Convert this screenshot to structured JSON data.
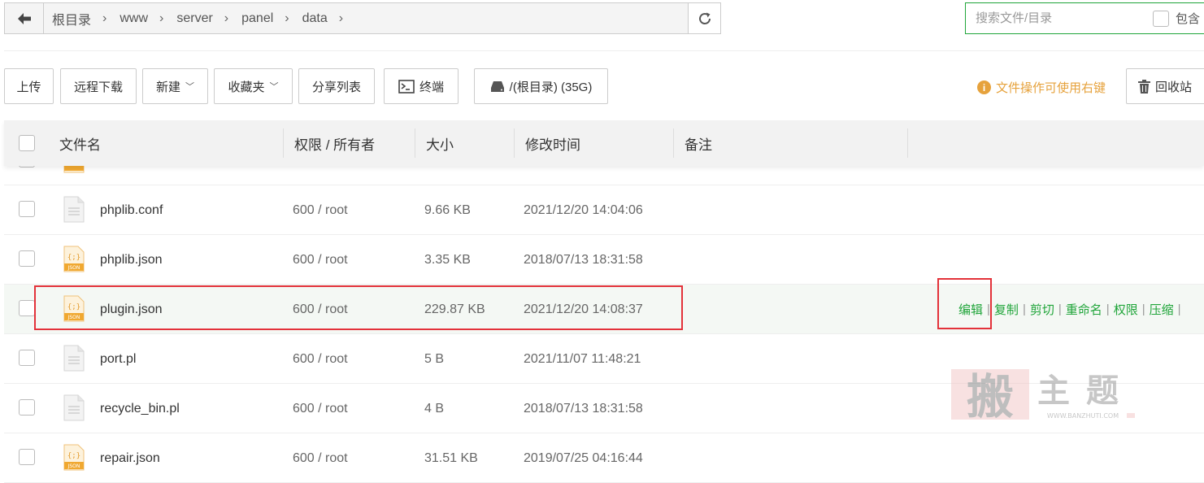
{
  "path": {
    "crumbs": [
      "根目录",
      "www",
      "server",
      "panel",
      "data"
    ]
  },
  "search": {
    "placeholder": "搜索文件/目录",
    "include_label": "包含"
  },
  "toolbar": {
    "upload": "上传",
    "remote_download": "远程下载",
    "new": "新建",
    "favorites": "收藏夹",
    "share_list": "分享列表",
    "terminal": "终端",
    "disk": "/(根目录) (35G)",
    "hint": "文件操作可使用右键",
    "recycle": "回收站"
  },
  "table": {
    "headers": {
      "name": "文件名",
      "perm": "权限 / 所有者",
      "size": "大小",
      "mtime": "修改时间",
      "remark": "备注"
    },
    "rows": [
      {
        "name": "phplib.conf",
        "perm": "600 / root",
        "size": "9.66 KB",
        "mtime": "2021/12/20 14:04:06",
        "icon": "doc-icon"
      },
      {
        "name": "phplib.json",
        "perm": "600 / root",
        "size": "3.35 KB",
        "mtime": "2018/07/13 18:31:58",
        "icon": "json-icon"
      },
      {
        "name": "plugin.json",
        "perm": "600 / root",
        "size": "229.87 KB",
        "mtime": "2021/12/20 14:08:37",
        "icon": "json-icon"
      },
      {
        "name": "port.pl",
        "perm": "600 / root",
        "size": "5 B",
        "mtime": "2021/11/07 11:48:21",
        "icon": "doc-icon"
      },
      {
        "name": "recycle_bin.pl",
        "perm": "600 / root",
        "size": "4 B",
        "mtime": "2018/07/13 18:31:58",
        "icon": "doc-icon"
      },
      {
        "name": "repair.json",
        "perm": "600 / root",
        "size": "31.51 KB",
        "mtime": "2019/07/25 04:16:44",
        "icon": "json-icon"
      }
    ],
    "actions": [
      "编辑",
      "复制",
      "剪切",
      "重命名",
      "权限",
      "压缩"
    ]
  },
  "watermark": {
    "text": "主题",
    "char": "搬",
    "url": "WWW.BANZHUTI.COM"
  },
  "colors": {
    "accent": "#20a53a",
    "highlight_box": "#e3323a",
    "hint": "#e6a23c",
    "json_icon": "#f0a830"
  }
}
